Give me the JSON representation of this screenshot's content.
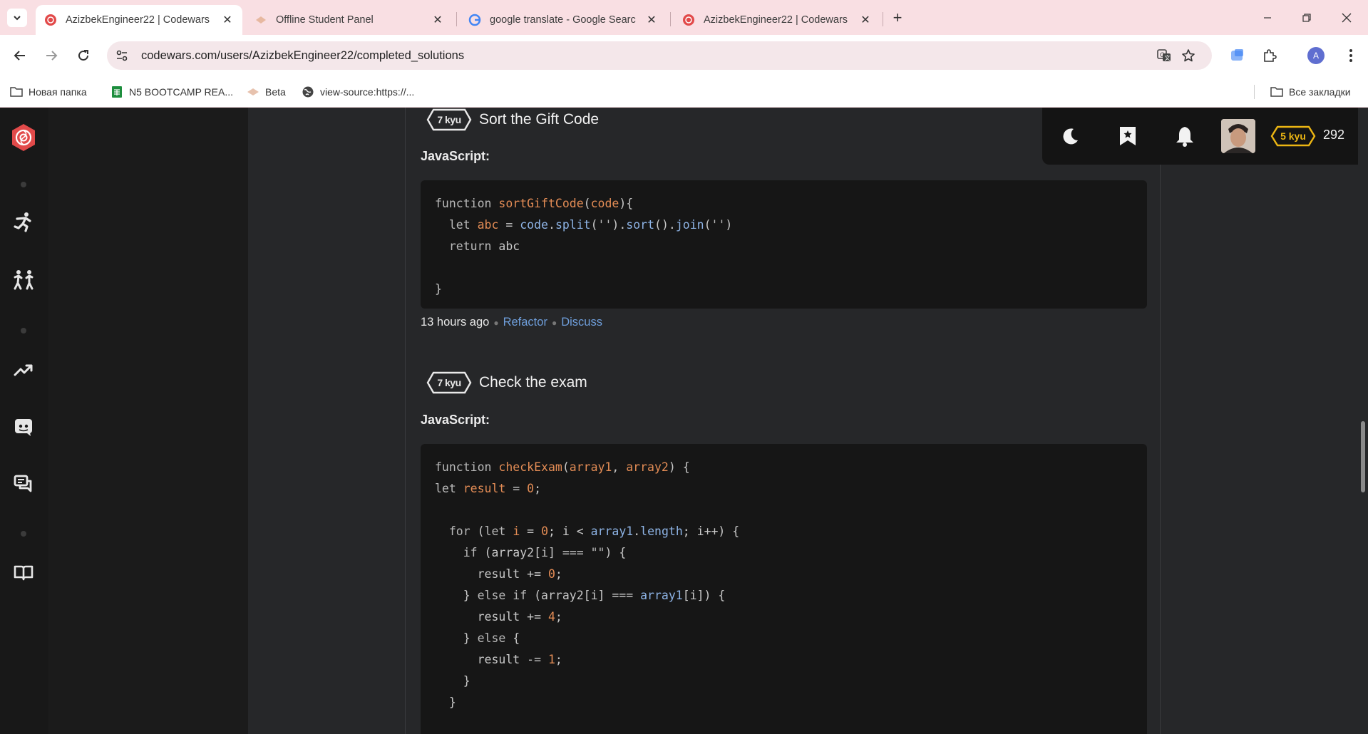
{
  "browser": {
    "tabs": [
      {
        "title": "AzizbekEngineer22 | Codewars",
        "active": true
      },
      {
        "title": "Offline Student Panel",
        "active": false
      },
      {
        "title": "google translate - Google Searc",
        "active": false
      },
      {
        "title": "AzizbekEngineer22 | Codewars",
        "active": false
      }
    ],
    "url": "codewars.com/users/AzizbekEngineer22/completed_solutions",
    "bookmarks": [
      {
        "label": "Новая папка",
        "icon": "folder-icon"
      },
      {
        "label": "N5 BOOTCAMP REA...",
        "icon": "sheets-icon"
      },
      {
        "label": "Beta",
        "icon": "beta-icon"
      },
      {
        "label": "view-source:https://...",
        "icon": "globe-icon"
      }
    ],
    "all_bookmarks": "Все закладки",
    "profile_initial": "A"
  },
  "user": {
    "rank": "5 kyu",
    "honor": "292"
  },
  "solutions": [
    {
      "kyu": "7 kyu",
      "name": "Sort the Gift Code",
      "language": "JavaScript:",
      "time": "13 hours ago",
      "refactor": "Refactor",
      "discuss": "Discuss"
    },
    {
      "kyu": "7 kyu",
      "name": "Check the exam",
      "language": "JavaScript:"
    }
  ],
  "colors": {
    "accent": "#e24a4a",
    "rank_yellow": "#ecb613",
    "link": "#6f9fdc",
    "keyword_orange": "#e38c55"
  }
}
